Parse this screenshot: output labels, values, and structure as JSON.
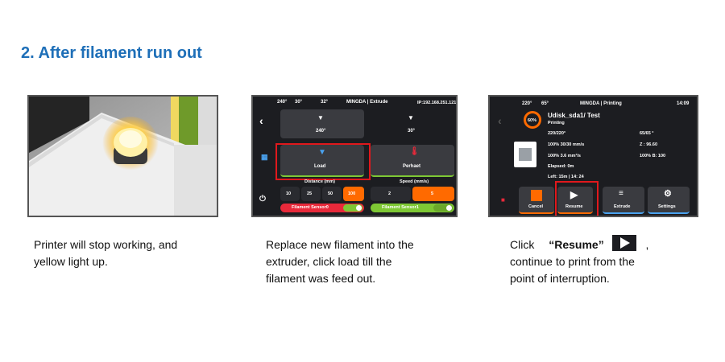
{
  "heading": "2. After filament run out",
  "step1": {
    "caption_line1": "Printer will stop working, and",
    "caption_line2": "yellow light up."
  },
  "step2": {
    "status": {
      "temp1": "240°",
      "temp2": "30°",
      "temp3": "32°",
      "title": "MINGDA | Extrude",
      "ip": "IP:192.168.251.121"
    },
    "tiles": {
      "t1": "240°",
      "t2": "30°",
      "load": "Load",
      "preheat": "Perhaet"
    },
    "distance_label": "Distance (mm)",
    "speed_label": "Speed (mm/s)",
    "distances": [
      "10",
      "25",
      "50",
      "100"
    ],
    "speeds": [
      "2",
      "5"
    ],
    "sensor0": "Filament Sensor0",
    "sensor1": "Filament Sensor1",
    "caption_line1": "Replace new filament into the",
    "caption_line2": "extruder, click load till the",
    "caption_line3": "filament was feed out."
  },
  "step3": {
    "status": {
      "temp1": "220°",
      "temp2": "65°",
      "title": "MINGDA | Printing",
      "time": "14:09"
    },
    "progress": "60%",
    "file": "Udisk_sda1/ Test",
    "state": "Printing",
    "stats": {
      "nozzle": "220/220°",
      "bed": "65/65 °",
      "speed": "100% 30/30 mm/s",
      "z": "Z : 96.60",
      "flow": "100%   3.6 mm³/s",
      "fan": "100% B: 100",
      "elapsed": "Elapsed: 0m",
      "left": "Left: 15m | 14: 24"
    },
    "buttons": {
      "cancel": "Cancel",
      "resume": "Resume",
      "extrude": "Extrude",
      "settings": "Settings"
    },
    "caption_click": "Click",
    "caption_resume": "“Resume”",
    "caption_comma": ",",
    "caption_line2": "continue to print from the",
    "caption_line3": "point of interruption."
  },
  "colors": {
    "heading": "#1e6fb8",
    "highlight": "#e0181c",
    "orange": "#ff6a00",
    "green": "#7ec834",
    "red": "#e8293a"
  }
}
